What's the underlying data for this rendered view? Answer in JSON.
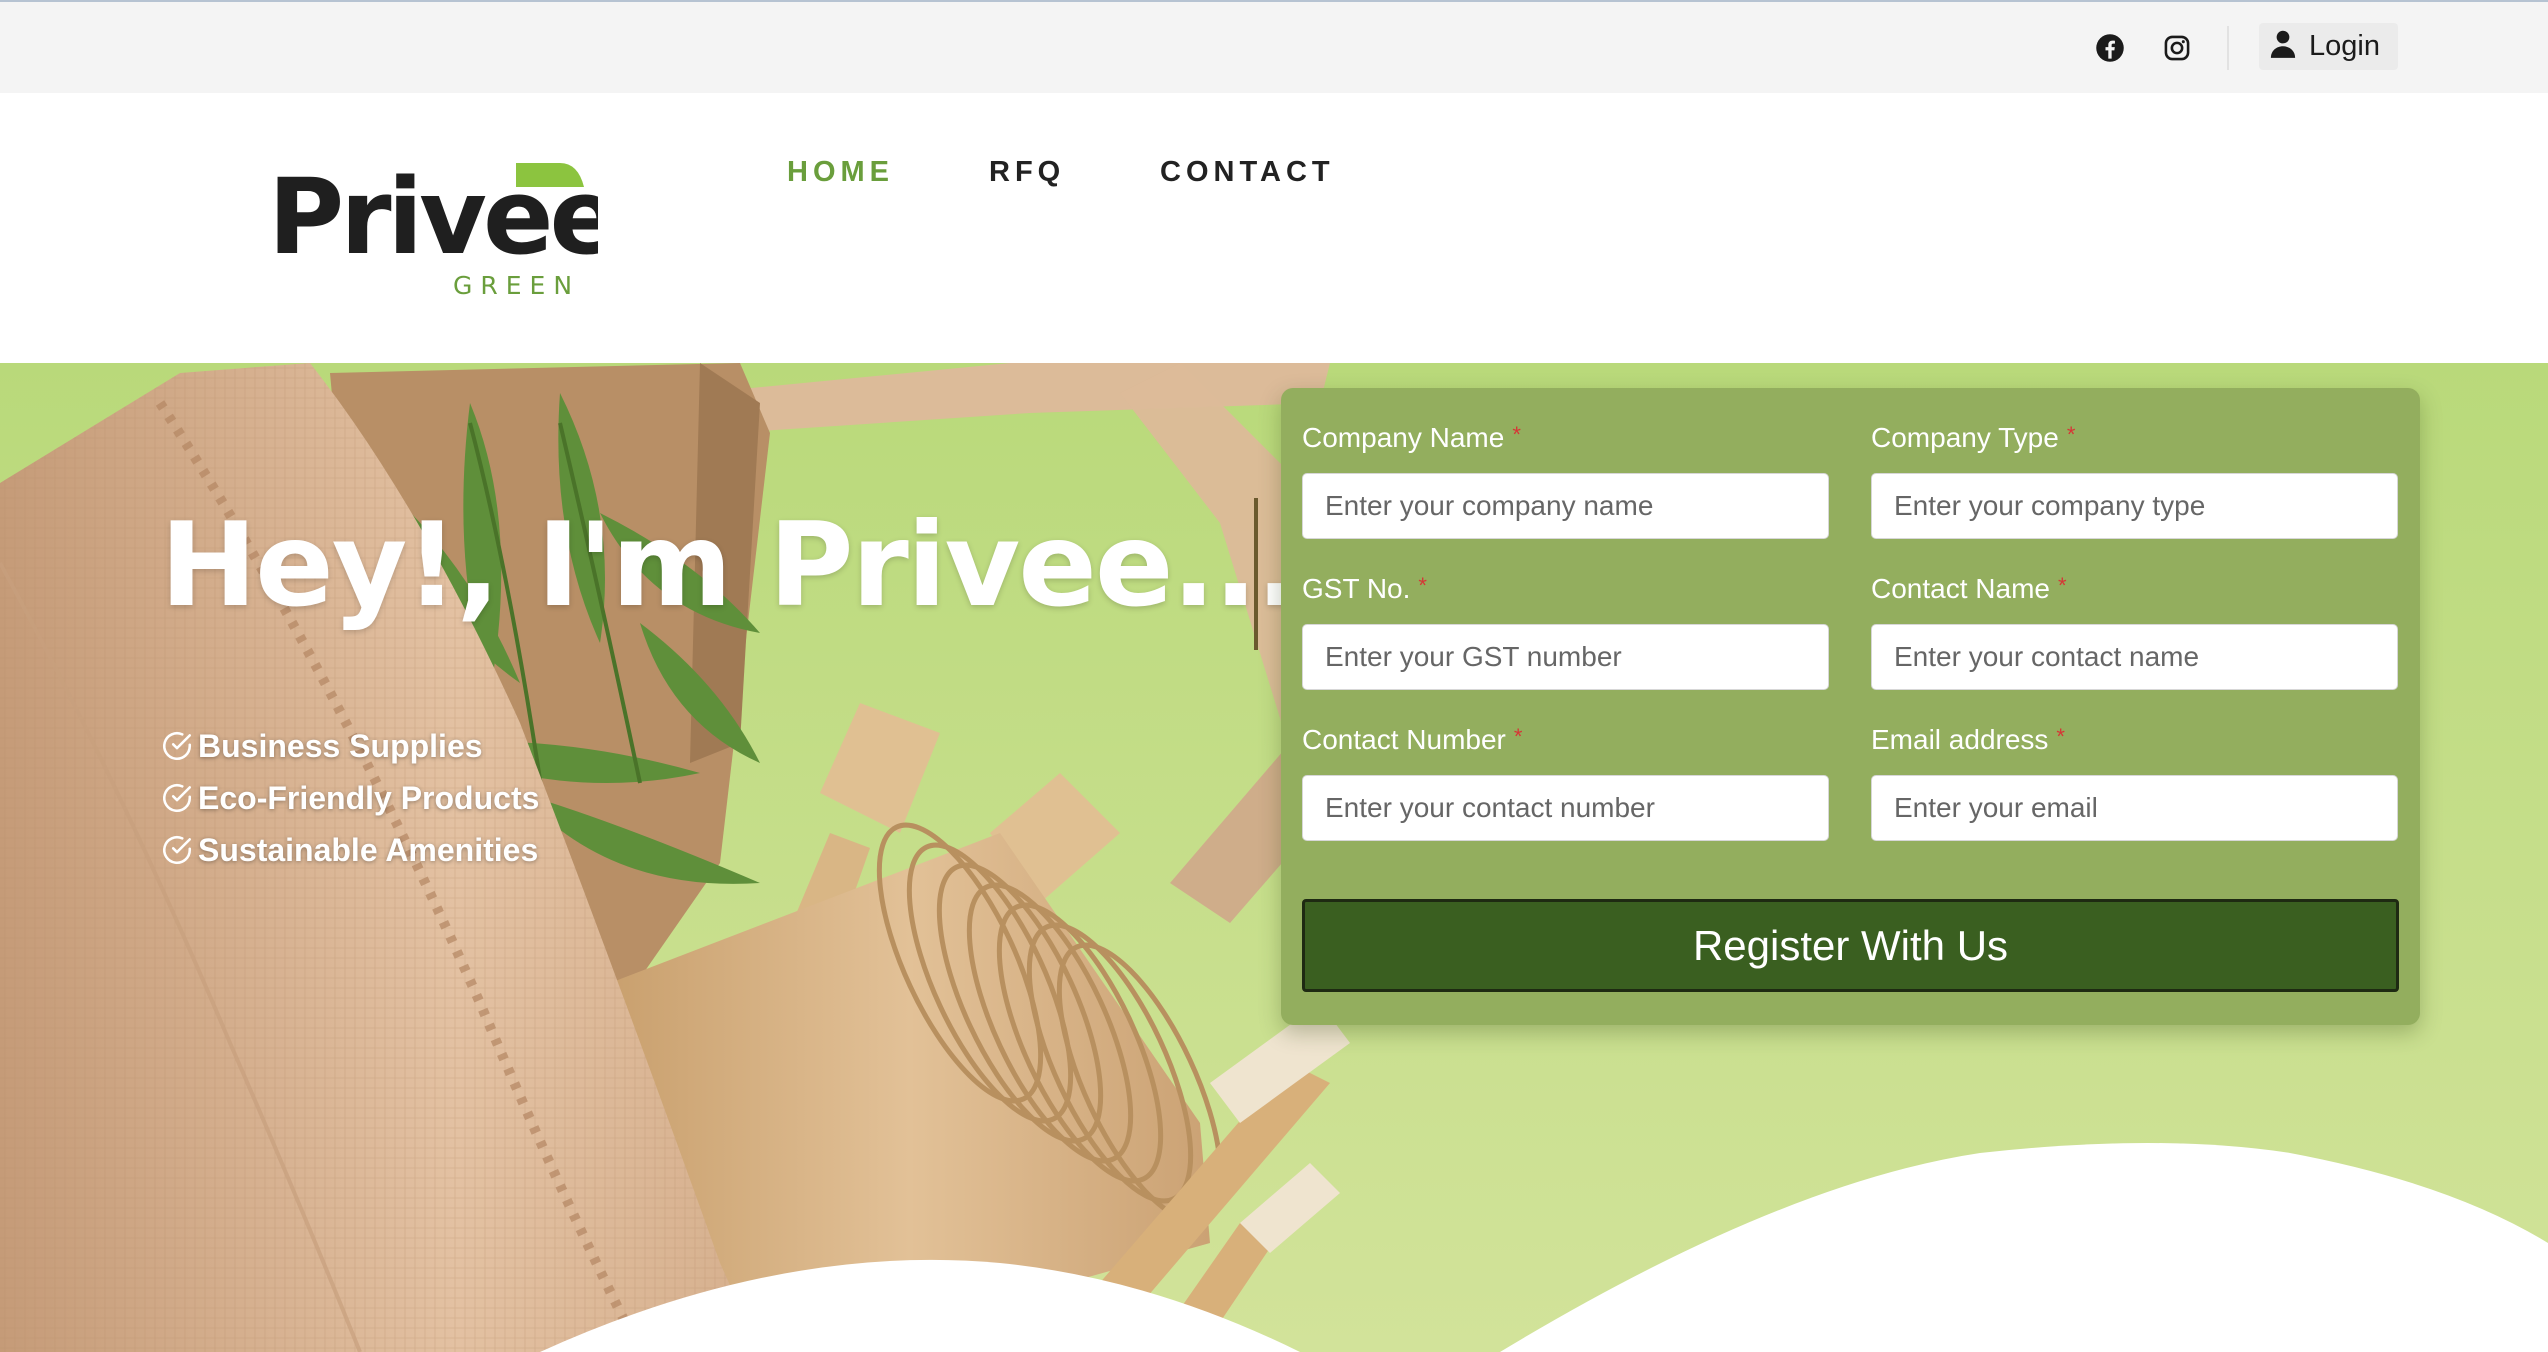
{
  "topbar": {
    "social": [
      {
        "icon": "facebook-icon"
      },
      {
        "icon": "instagram-icon"
      }
    ],
    "login": {
      "icon": "user-icon",
      "label": "Login"
    }
  },
  "header": {
    "logo": {
      "name": "Privee",
      "tagline": "GREEN",
      "accent_color": "#8cc43f"
    },
    "nav": [
      {
        "label": "HOME",
        "active": true
      },
      {
        "label": "RFQ",
        "active": false
      },
      {
        "label": "CONTACT",
        "active": false
      }
    ]
  },
  "hero": {
    "headline": "Hey!, I'm Privee...",
    "features": [
      {
        "icon": "check-circle-icon",
        "label": "Business Supplies"
      },
      {
        "icon": "check-circle-icon",
        "label": "Eco-Friendly Products"
      },
      {
        "icon": "check-circle-icon",
        "label": "Sustainable Amenities"
      }
    ]
  },
  "form": {
    "required_mark": "*",
    "fields": {
      "company_name": {
        "label": "Company Name",
        "placeholder": "Enter your company name",
        "value": ""
      },
      "company_type": {
        "label": "Company Type",
        "placeholder": "Enter your company type",
        "value": ""
      },
      "gst_no": {
        "label": "GST No.",
        "placeholder": "Enter your GST number",
        "value": ""
      },
      "contact_name": {
        "label": "Contact Name",
        "placeholder": "Enter your contact name",
        "value": ""
      },
      "contact_number": {
        "label": "Contact Number",
        "placeholder": "Enter your contact number",
        "value": ""
      },
      "email": {
        "label": "Email address",
        "placeholder": "Enter your email",
        "value": ""
      }
    },
    "submit_label": "Register With Us"
  },
  "colors": {
    "brand_green": "#6a9e3c",
    "form_panel": "#93ae5e",
    "button_green": "#3a5f20",
    "hero_background": "#c3dc8c",
    "required": "#d63636"
  }
}
